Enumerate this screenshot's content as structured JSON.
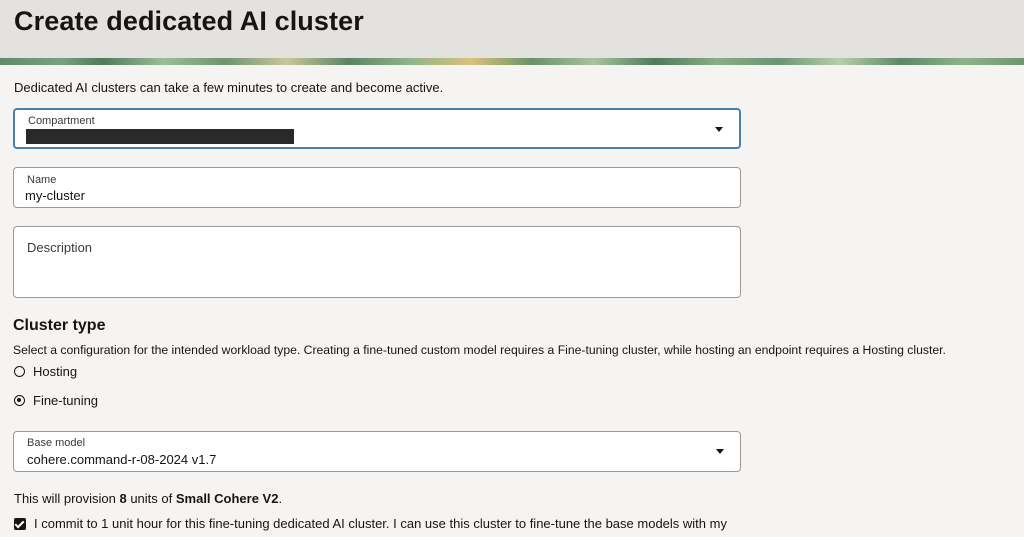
{
  "header": {
    "title": "Create dedicated AI cluster"
  },
  "intro": "Dedicated AI clusters can take a few minutes to create and become active.",
  "compartment": {
    "label": "Compartment",
    "value": ""
  },
  "name": {
    "label": "Name",
    "value": "my-cluster"
  },
  "description": {
    "label": "Description",
    "value": ""
  },
  "cluster_type": {
    "title": "Cluster type",
    "description": "Select a configuration for the intended workload type. Creating a fine-tuned custom model requires a Fine-tuning cluster, while hosting an endpoint requires a Hosting cluster.",
    "options": [
      {
        "label": "Hosting",
        "selected": false
      },
      {
        "label": "Fine-tuning",
        "selected": true
      }
    ]
  },
  "base_model": {
    "label": "Base model",
    "value": "cohere.command-r-08-2024 v1.7"
  },
  "provision": {
    "prefix": "This will provision ",
    "units": "8",
    "middle": " units of ",
    "shape": "Small Cohere V2",
    "suffix": "."
  },
  "commit": {
    "checked": true,
    "text": "I commit to 1 unit hour for this fine-tuning dedicated AI cluster. I can use this cluster to fine-tune the base models with my"
  },
  "colors": {
    "focus_border": "#4b7fa7",
    "page_bg": "#f5f4f2",
    "header_bg": "#e4e2df"
  },
  "icons": {
    "dropdown": "chevron-down-icon",
    "check": "checkmark-icon"
  }
}
